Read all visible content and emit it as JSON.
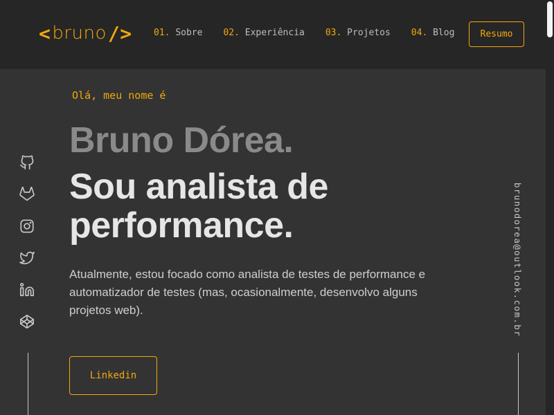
{
  "header": {
    "logo": {
      "open_bracket": "<",
      "name": "bruno",
      "close_bracket": "/>"
    },
    "nav": [
      {
        "num": "01.",
        "label": "Sobre"
      },
      {
        "num": "02.",
        "label": "Experiência"
      },
      {
        "num": "03.",
        "label": "Projetos"
      },
      {
        "num": "04.",
        "label": "Blog"
      }
    ],
    "resume_label": "Resumo"
  },
  "hero": {
    "greeting": "Olá, meu nome é",
    "name": "Bruno Dórea.",
    "title": "Sou analista de performance.",
    "description": "Atualmente, estou focado como analista de testes de performance e automatizador de testes (mas, ocasionalmente, desenvolvo alguns projetos web).",
    "cta_label": "Linkedin"
  },
  "social": [
    {
      "icon": "github-icon"
    },
    {
      "icon": "gitlab-icon"
    },
    {
      "icon": "instagram-icon"
    },
    {
      "icon": "twitter-icon"
    },
    {
      "icon": "linkedin-icon"
    },
    {
      "icon": "codepen-icon"
    }
  ],
  "email": "brunodorea@outlook.com.br",
  "colors": {
    "accent": "#f2a80d",
    "background": "#333333",
    "header_background": "#262626",
    "heading": "#e6e6e6",
    "name": "#8a8a8a"
  }
}
